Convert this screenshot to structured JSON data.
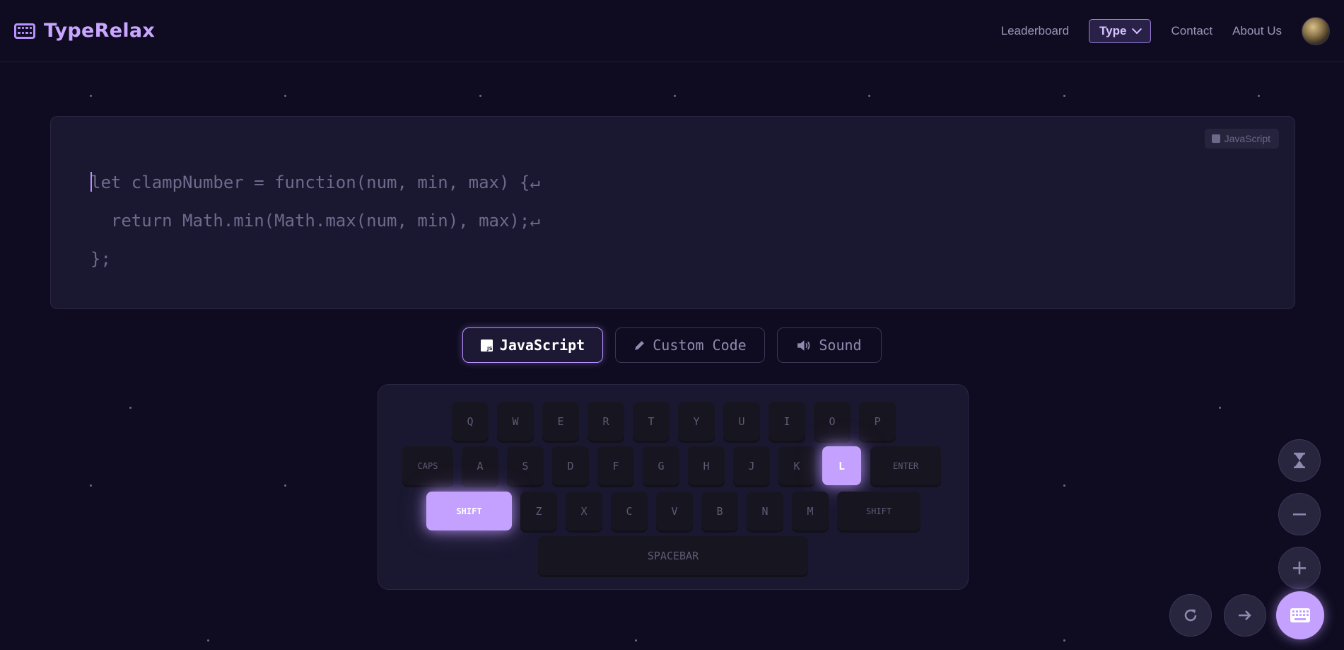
{
  "header": {
    "brand": "TypeRelax",
    "nav": {
      "leaderboard": "Leaderboard",
      "type": "Type",
      "contact": "Contact",
      "about": "About Us"
    }
  },
  "code_panel": {
    "language_badge": "JavaScript",
    "lines": [
      "let clampNumber = function(num, min, max) {",
      "  return Math.min(Math.max(num, min), max);",
      "};"
    ],
    "return_symbol": "↵"
  },
  "modes": [
    {
      "label": "JavaScript",
      "active": true,
      "icon": "js-icon"
    },
    {
      "label": "Custom Code",
      "active": false,
      "icon": "pencil-icon"
    },
    {
      "label": "Sound",
      "active": false,
      "icon": "speaker-icon"
    }
  ],
  "keyboard": {
    "row1": [
      "Q",
      "W",
      "E",
      "R",
      "T",
      "Y",
      "U",
      "I",
      "O",
      "P"
    ],
    "row2_caps": "CAPS",
    "row2": [
      "A",
      "S",
      "D",
      "F",
      "G",
      "H",
      "J",
      "K",
      "L"
    ],
    "row2_enter": "ENTER",
    "row3_shift_left": "SHIFT",
    "row3": [
      "Z",
      "X",
      "C",
      "V",
      "B",
      "N",
      "M"
    ],
    "row3_shift_right": "SHIFT",
    "space": "SPACEBAR",
    "highlighted": [
      "L",
      "SHIFT"
    ]
  },
  "controls": {
    "timer_icon": "hourglass-icon",
    "decrease_icon": "minus-icon",
    "increase_icon": "plus-icon",
    "restart_icon": "refresh-icon",
    "next_icon": "arrow-right-icon",
    "keyboard_toggle_icon": "keyboard-icon"
  },
  "colors": {
    "background": "#0f0c21",
    "accent": "#b892ff",
    "key_lit": "#c4a1ff",
    "panel": "#1a1830"
  }
}
